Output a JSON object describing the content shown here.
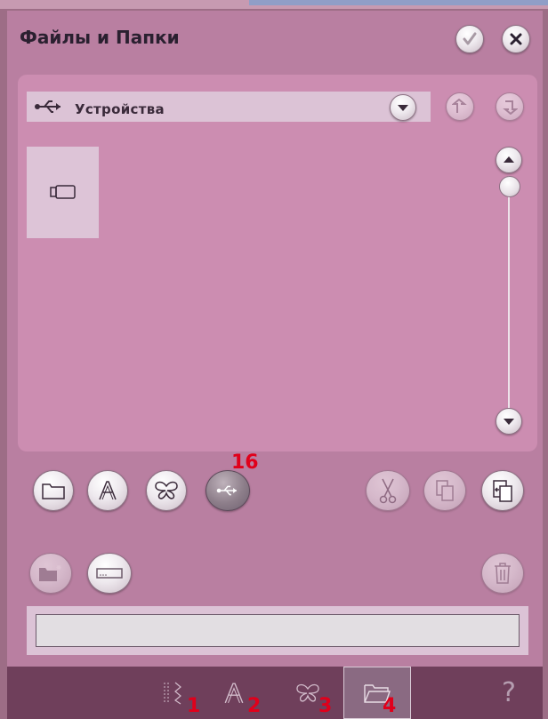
{
  "window": {
    "title": "Файлы и Папки"
  },
  "header": {
    "confirm_icon": "checkmark-icon",
    "close_icon": "close-icon"
  },
  "browser": {
    "location_label": "Устройства",
    "location_icon": "usb-icon",
    "items": [
      {
        "icon": "usb-drive-icon"
      }
    ]
  },
  "toolbar": {
    "callout": "16",
    "buttons_left": [
      "folder-icon",
      "font-icon",
      "butterfly-icon",
      "usb-icon"
    ],
    "buttons_right": [
      "cut-icon",
      "copy-icon",
      "paste-icon"
    ],
    "row2": [
      "new-folder-icon",
      "rename-icon",
      "trash-icon"
    ]
  },
  "bottom_tabs": [
    {
      "icon": "stitch-icon",
      "number": "1"
    },
    {
      "icon": "font-icon",
      "number": "2"
    },
    {
      "icon": "butterfly-icon",
      "number": "3"
    },
    {
      "icon": "folder-icon",
      "number": "4",
      "selected": true
    }
  ],
  "help": {
    "label": "?"
  },
  "colors": {
    "panel": "#b97fa1",
    "inner": "#cc8db1",
    "bottom": "#6f3f5b",
    "callout": "#e0001b"
  }
}
